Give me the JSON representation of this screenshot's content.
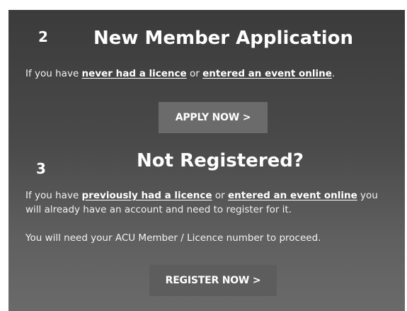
{
  "section_new": {
    "step_number": "2",
    "heading": "New Member Application",
    "text_prefix": "If you have ",
    "link_1": "never had a licence",
    "text_mid": " or ",
    "link_2": "entered an event online",
    "text_end": ".",
    "button_label": "APPLY NOW >"
  },
  "section_registered": {
    "step_number": "3",
    "heading": "Not Registered?",
    "text_prefix": "If you have ",
    "link_1": "previously had a licence",
    "text_mid": " or ",
    "link_2": "entered an event online",
    "text_after": " you",
    "text_line2": "will already have an account and need to register for it.",
    "text_note": "You will need your ACU Member / Licence number to proceed.",
    "button_label": "REGISTER NOW >"
  },
  "colors": {
    "panel_top": "#3b3b3b",
    "panel_bottom": "#6a6a6a",
    "apply_button": "#6b6b6b",
    "register_button": "#5d5d5d",
    "text": "#ffffff"
  }
}
